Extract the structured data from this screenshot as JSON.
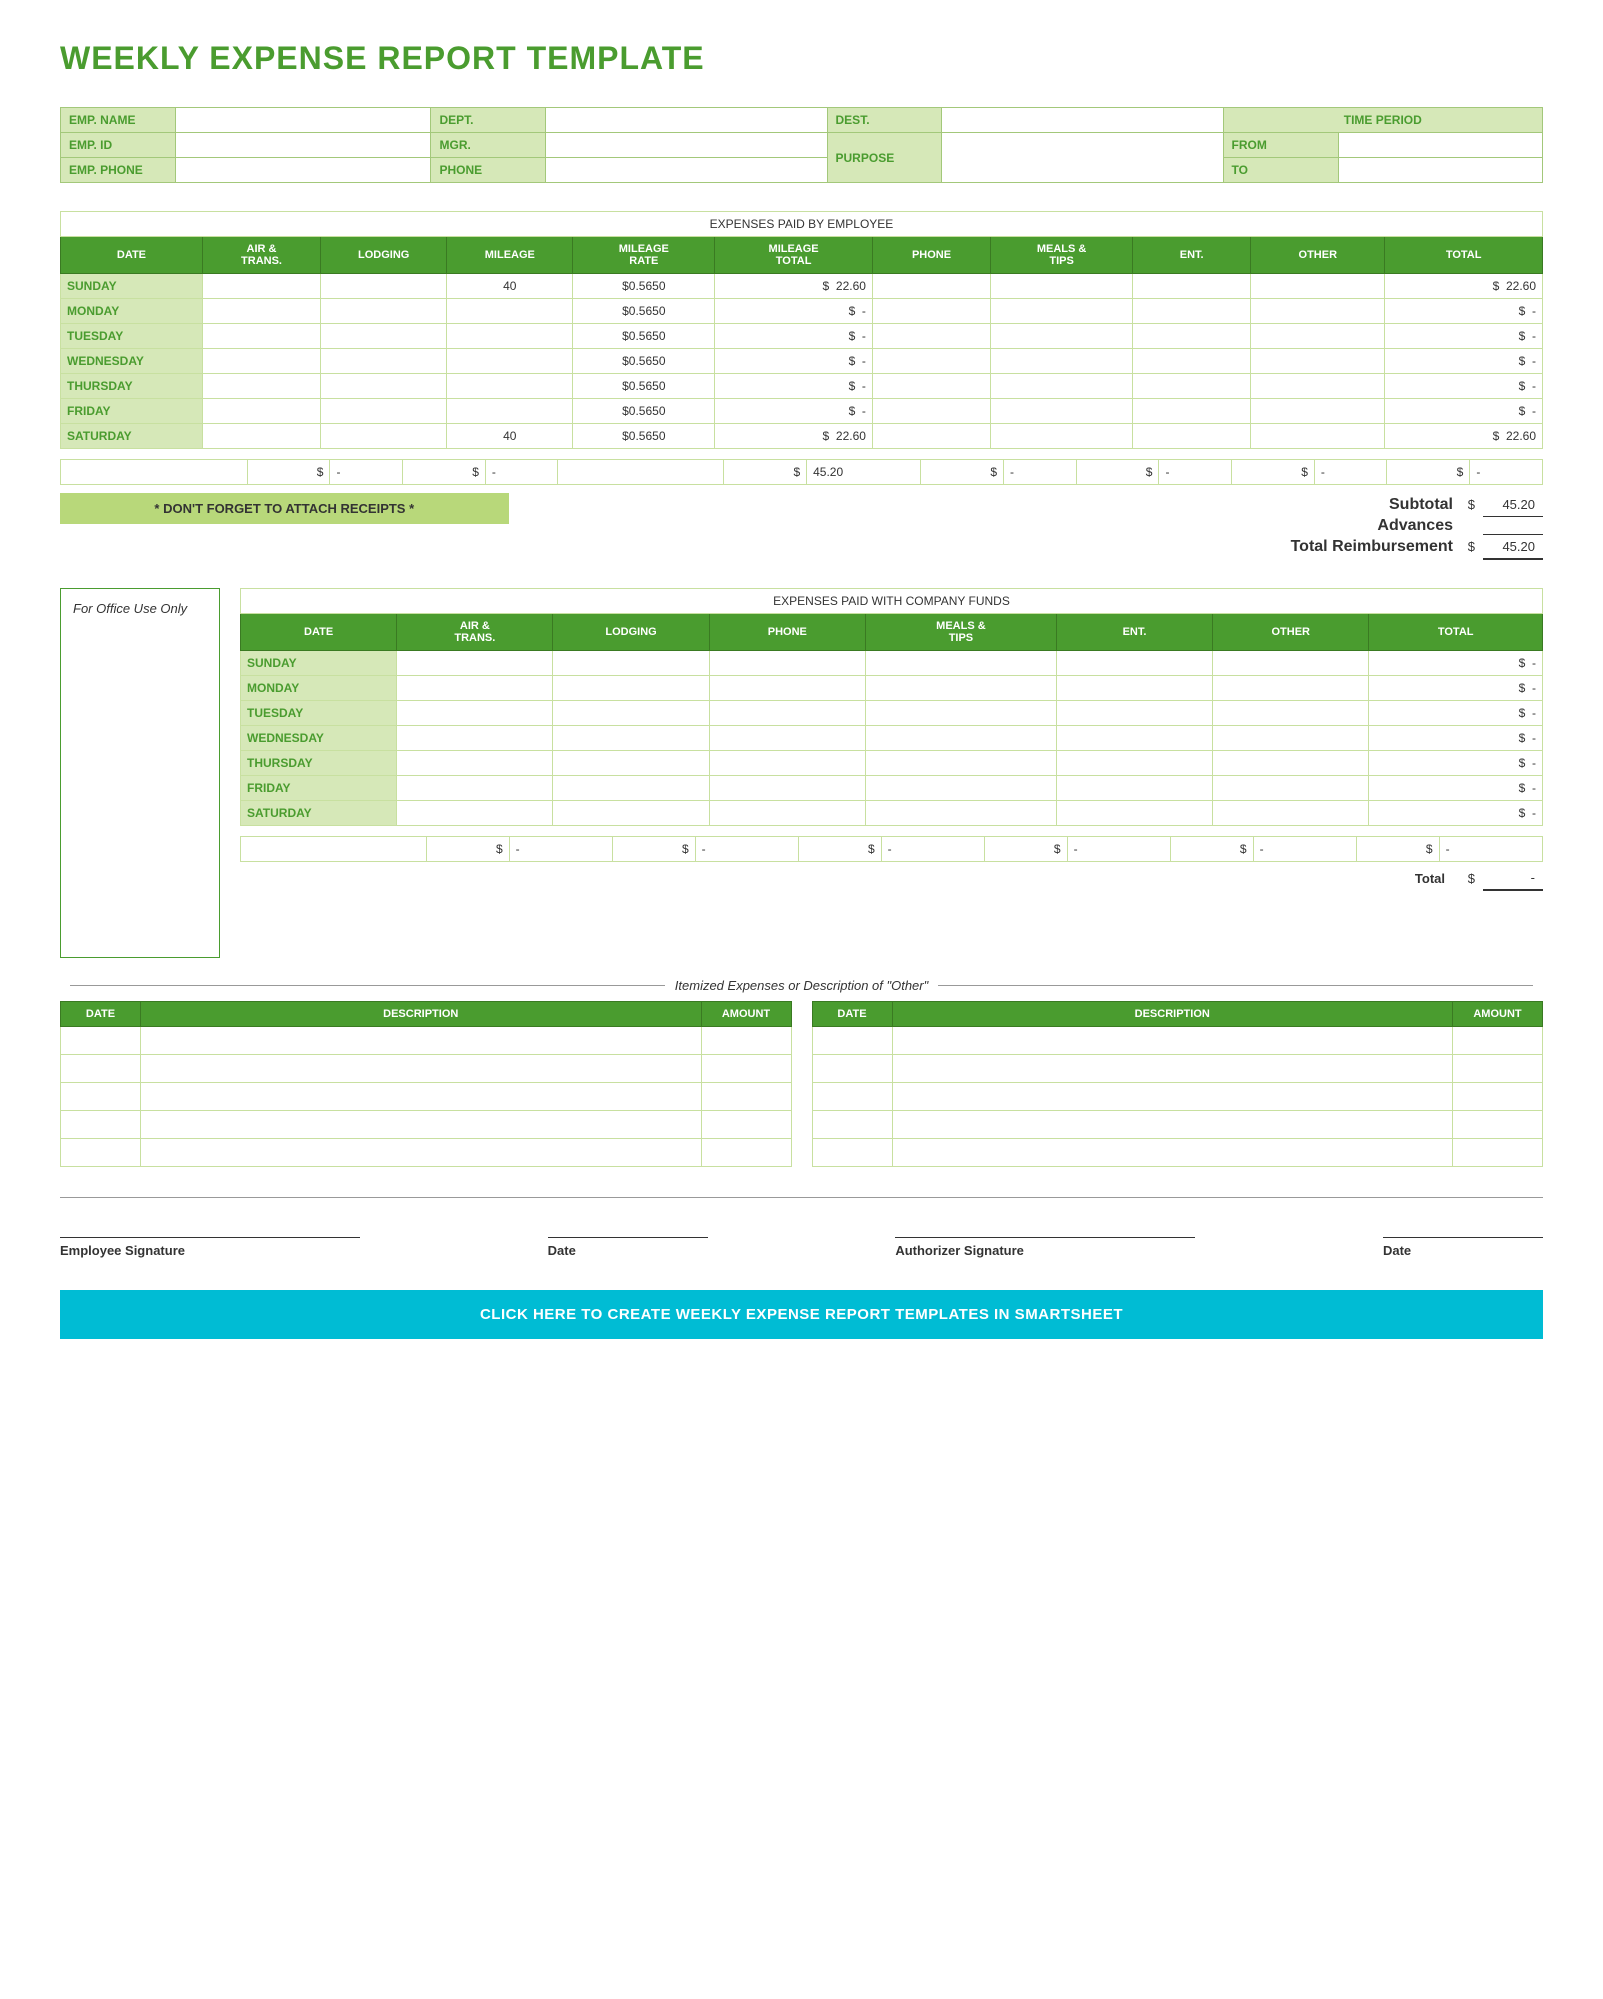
{
  "title": "WEEKLY EXPENSE REPORT TEMPLATE",
  "info": {
    "emp_name_label": "EMP. NAME",
    "dept_label": "DEPT.",
    "dest_label": "DEST.",
    "time_period_label": "TIME PERIOD",
    "emp_id_label": "EMP. ID",
    "mgr_label": "MGR.",
    "from_label": "FROM",
    "to_label": "TO",
    "emp_phone_label": "EMP. PHONE",
    "phone_label": "PHONE",
    "purpose_label": "PURPOSE"
  },
  "expenses_paid_employee": {
    "section_title": "EXPENSES PAID BY EMPLOYEE",
    "columns": [
      "DATE",
      "AIR & TRANS.",
      "LODGING",
      "MILEAGE",
      "MILEAGE RATE",
      "MILEAGE TOTAL",
      "PHONE",
      "MEALS & TIPS",
      "ENT.",
      "OTHER",
      "TOTAL"
    ],
    "rows": [
      {
        "day": "SUNDAY",
        "air": "",
        "lodging": "",
        "mileage": "40",
        "rate": "$0.5650",
        "mile_total_dollar": "$",
        "mile_total_val": "22.60",
        "phone": "",
        "meals": "",
        "ent": "",
        "other": "",
        "total_dollar": "$",
        "total_val": "22.60"
      },
      {
        "day": "MONDAY",
        "air": "",
        "lodging": "",
        "mileage": "",
        "rate": "$0.5650",
        "mile_total_dollar": "$",
        "mile_total_val": "-",
        "phone": "",
        "meals": "",
        "ent": "",
        "other": "",
        "total_dollar": "$",
        "total_val": "-"
      },
      {
        "day": "TUESDAY",
        "air": "",
        "lodging": "",
        "mileage": "",
        "rate": "$0.5650",
        "mile_total_dollar": "$",
        "mile_total_val": "-",
        "phone": "",
        "meals": "",
        "ent": "",
        "other": "",
        "total_dollar": "$",
        "total_val": "-"
      },
      {
        "day": "WEDNESDAY",
        "air": "",
        "lodging": "",
        "mileage": "",
        "rate": "$0.5650",
        "mile_total_dollar": "$",
        "mile_total_val": "-",
        "phone": "",
        "meals": "",
        "ent": "",
        "other": "",
        "total_dollar": "$",
        "total_val": "-"
      },
      {
        "day": "THURSDAY",
        "air": "",
        "lodging": "",
        "mileage": "",
        "rate": "$0.5650",
        "mile_total_dollar": "$",
        "mile_total_val": "-",
        "phone": "",
        "meals": "",
        "ent": "",
        "other": "",
        "total_dollar": "$",
        "total_val": "-"
      },
      {
        "day": "FRIDAY",
        "air": "",
        "lodging": "",
        "mileage": "",
        "rate": "$0.5650",
        "mile_total_dollar": "$",
        "mile_total_val": "-",
        "phone": "",
        "meals": "",
        "ent": "",
        "other": "",
        "total_dollar": "$",
        "total_val": "-"
      },
      {
        "day": "SATURDAY",
        "air": "",
        "lodging": "",
        "mileage": "40",
        "rate": "$0.5650",
        "mile_total_dollar": "$",
        "mile_total_val": "22.60",
        "phone": "",
        "meals": "",
        "ent": "",
        "other": "",
        "total_dollar": "$",
        "total_val": "22.60"
      }
    ],
    "totals_row": {
      "air_dollar": "$",
      "air_val": "-",
      "lodging_dollar": "$",
      "lodging_val": "-",
      "mile_total_dollar": "$",
      "mile_total_val": "45.20",
      "phone_dollar": "$",
      "phone_val": "-",
      "meals_dollar": "$",
      "meals_val": "-",
      "ent_dollar": "$",
      "ent_val": "-",
      "other_dollar": "$",
      "other_val": "-"
    },
    "subtotal_label": "Subtotal",
    "subtotal_dollar": "$",
    "subtotal_val": "45.20",
    "advances_label": "Advances",
    "advances_dollar": "",
    "advances_val": "",
    "total_reimbursement_label": "Total Reimbursement",
    "total_reimbursement_dollar": "$",
    "total_reimbursement_val": "45.20",
    "receipt_reminder": "* DON'T FORGET TO ATTACH RECEIPTS *"
  },
  "office_use": {
    "label": "For Office Use Only"
  },
  "expenses_company_funds": {
    "section_title": "EXPENSES PAID WITH COMPANY FUNDS",
    "columns": [
      "DATE",
      "AIR & TRANS.",
      "LODGING",
      "PHONE",
      "MEALS & TIPS",
      "ENT.",
      "OTHER",
      "TOTAL"
    ],
    "rows": [
      {
        "day": "SUNDAY",
        "air": "",
        "lodging": "",
        "phone": "",
        "meals": "",
        "ent": "",
        "other": "",
        "total_dollar": "$",
        "total_val": "-"
      },
      {
        "day": "MONDAY",
        "air": "",
        "lodging": "",
        "phone": "",
        "meals": "",
        "ent": "",
        "other": "",
        "total_dollar": "$",
        "total_val": "-"
      },
      {
        "day": "TUESDAY",
        "air": "",
        "lodging": "",
        "phone": "",
        "meals": "",
        "ent": "",
        "other": "",
        "total_dollar": "$",
        "total_val": "-"
      },
      {
        "day": "WEDNESDAY",
        "air": "",
        "lodging": "",
        "phone": "",
        "meals": "",
        "ent": "",
        "other": "",
        "total_dollar": "$",
        "total_val": "-"
      },
      {
        "day": "THURSDAY",
        "air": "",
        "lodging": "",
        "phone": "",
        "meals": "",
        "ent": "",
        "other": "",
        "total_dollar": "$",
        "total_val": "-"
      },
      {
        "day": "FRIDAY",
        "air": "",
        "lodging": "",
        "phone": "",
        "meals": "",
        "ent": "",
        "other": "",
        "total_dollar": "$",
        "total_val": "-"
      },
      {
        "day": "SATURDAY",
        "air": "",
        "lodging": "",
        "phone": "",
        "meals": "",
        "ent": "",
        "other": "",
        "total_dollar": "$",
        "total_val": "-"
      }
    ],
    "totals_row": {
      "air_dollar": "$",
      "air_val": "-",
      "lodging_dollar": "$",
      "lodging_val": "-",
      "phone_dollar": "$",
      "phone_val": "-",
      "meals_dollar": "$",
      "meals_val": "-",
      "ent_dollar": "$",
      "ent_val": "-",
      "other_dollar": "$",
      "other_val": "-"
    },
    "total_label": "Total",
    "total_dollar": "$",
    "total_val": "-"
  },
  "itemized": {
    "section_title": "Itemized Expenses or Description of \"Other\"",
    "left_columns": [
      "DATE",
      "DESCRIPTION",
      "AMOUNT"
    ],
    "right_columns": [
      "DATE",
      "DESCRIPTION",
      "AMOUNT"
    ],
    "empty_rows": 5
  },
  "signatures": {
    "employee_label": "Employee Signature",
    "date_label1": "Date",
    "authorizer_label": "Authorizer Signature",
    "date_label2": "Date"
  },
  "cta": {
    "label": "CLICK HERE TO CREATE WEEKLY EXPENSE REPORT TEMPLATES IN SMARTSHEET"
  }
}
